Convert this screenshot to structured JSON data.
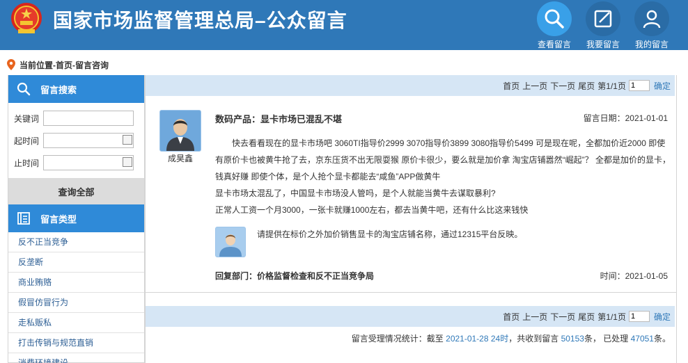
{
  "header": {
    "title": "国家市场监督管理总局–公众留言",
    "buttons": [
      {
        "label": "查看留言",
        "icon": "search-icon"
      },
      {
        "label": "我要留言",
        "icon": "edit-icon"
      },
      {
        "label": "我的留言",
        "icon": "user-icon"
      }
    ]
  },
  "breadcrumb": "当前位置-首页-留言咨询",
  "sidebar": {
    "search_title": "留言搜索",
    "keyword_label": "关键词",
    "keyword_value": "",
    "start_label": "起时间",
    "start_value": "",
    "end_label": "止时间",
    "end_value": "",
    "query_all": "查询全部",
    "types_title": "留言类型",
    "types": [
      "反不正当竞争",
      "反垄断",
      "商业贿赂",
      "假冒仿冒行为",
      "走私贩私",
      "打击传销与规范直销",
      "消费环境建设"
    ]
  },
  "pager": {
    "first": "首页",
    "prev": "上一页",
    "next": "下一页",
    "last": "尾页",
    "page_info": "第1/1页",
    "page_input": "1",
    "confirm": "确定"
  },
  "message": {
    "author": "成昊鑫",
    "title": "数码产品：显卡市场已混乱不堪",
    "date": "留言日期：2021-01-01",
    "body": [
      "快去看看现在的显卡市场吧 3060TI指导价2999 3070指导价3899 3080指导价5499 可是现在呢，全都加价近2000 即使有原价卡也被黄牛抢了去，京东压货不出无限耍猴 原价卡很少，要么就是加价拿 淘宝店铺嚣然“崛起”？ 全都是加价的显卡，钱真好赚 即使个体，是个人抢个显卡都能去“咸鱼”APP做黄牛",
      "显卡市场太混乱了，中国显卡市场没人管吗，是个人就能当黄牛去谋取暴利?",
      "正常人工资一个月3000，一张卡就赚1000左右，都去当黄牛吧，还有什么比这来钱快"
    ],
    "reply": "请提供在标价之外加价销售显卡的淘宝店铺名称，通过12315平台反映。",
    "reply_dept": "回复部门：价格监督检查和反不正当竞争局",
    "reply_time": "时间：2021-01-05"
  },
  "stats": {
    "prefix": "留言受理情况统计：截至 ",
    "date": "2021-01-28 24时",
    "mid1": "，共收到留言 ",
    "received": "50153",
    "mid2": "条，  已处理 ",
    "processed": "47051",
    "suffix": "条。"
  },
  "colors": {
    "header_bg": "#2f78b8",
    "accent": "#2f8ad8",
    "pager_bg": "#d6e6f5"
  }
}
